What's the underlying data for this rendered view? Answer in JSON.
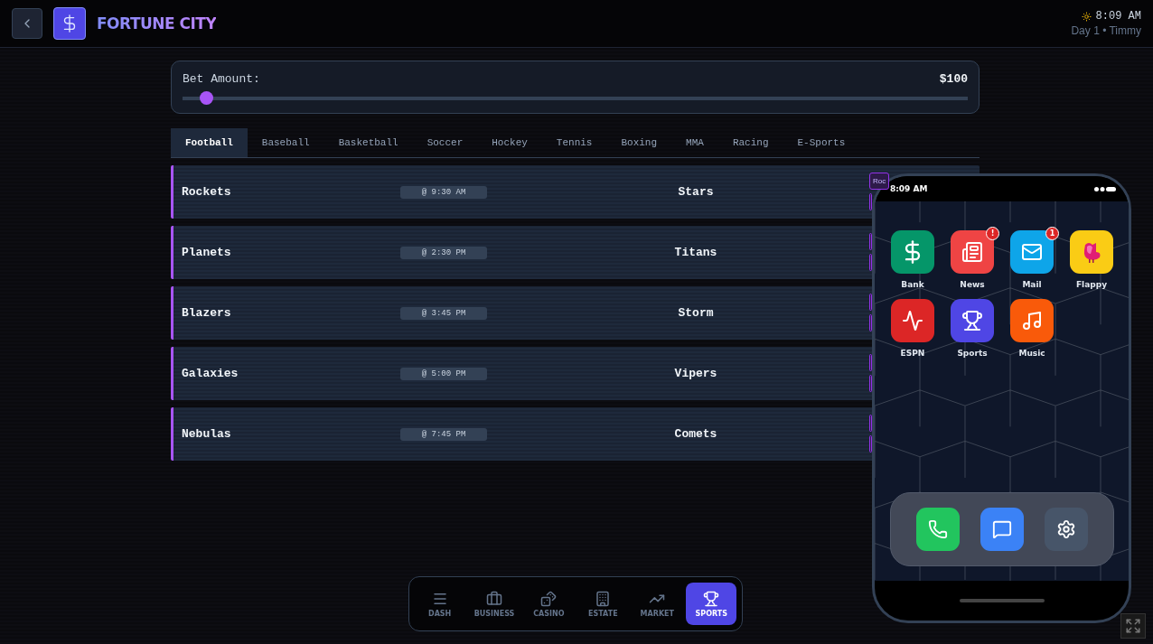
{
  "header": {
    "title": "FORTUNE CITY",
    "time": "8:09 AM",
    "subtitle": "Day 1 • Timmy"
  },
  "bet": {
    "label": "Bet Amount:",
    "value": "$100",
    "level": 0.03
  },
  "tabs": [
    {
      "label": "Football",
      "selected": true
    },
    {
      "label": "Baseball",
      "selected": false
    },
    {
      "label": "Basketball",
      "selected": false
    },
    {
      "label": "Soccer",
      "selected": false
    },
    {
      "label": "Hockey",
      "selected": false
    },
    {
      "label": "Tennis",
      "selected": false
    },
    {
      "label": "Boxing",
      "selected": false
    },
    {
      "label": "MMA",
      "selected": false
    },
    {
      "label": "Racing",
      "selected": false
    },
    {
      "label": "E-Sports",
      "selected": false
    }
  ],
  "games": [
    {
      "home": "Rockets",
      "time": "@ 9:30 AM",
      "away": "Stars",
      "bet_label": "Roc"
    },
    {
      "home": "Planets",
      "time": "@ 2:30 PM",
      "away": "Titans"
    },
    {
      "home": "Blazers",
      "time": "@ 3:45 PM",
      "away": "Storm"
    },
    {
      "home": "Galaxies",
      "time": "@ 5:00 PM",
      "away": "Vipers"
    },
    {
      "home": "Nebulas",
      "time": "@ 7:45 PM",
      "away": "Comets"
    }
  ],
  "phone": {
    "time": "8:09 AM",
    "apps": [
      {
        "name": "Bank",
        "kind": "bank",
        "color": "#059669"
      },
      {
        "name": "News",
        "kind": "news",
        "color": "#ef4444",
        "badge": "!"
      },
      {
        "name": "Mail",
        "kind": "mail",
        "color": "#0ea5e9",
        "badge": "1"
      },
      {
        "name": "Flappy",
        "kind": "flappy",
        "color": "#facc15"
      },
      {
        "name": "ESPN",
        "kind": "espn",
        "color": "#dc2626"
      },
      {
        "name": "Sports",
        "kind": "sports",
        "color": "#4f46e5"
      },
      {
        "name": "Music",
        "kind": "music",
        "color": "#f95a0a"
      }
    ],
    "dock": [
      {
        "kind": "phone",
        "color": "#22c55e"
      },
      {
        "kind": "messages",
        "color": "#3b82f6"
      },
      {
        "kind": "settings",
        "color": "#475569"
      }
    ]
  },
  "nav": [
    {
      "label": "DASH",
      "kind": "dash",
      "selected": false
    },
    {
      "label": "BUSINESS",
      "kind": "business",
      "selected": false
    },
    {
      "label": "CASINO",
      "kind": "casino",
      "selected": false
    },
    {
      "label": "ESTATE",
      "kind": "estate",
      "selected": false
    },
    {
      "label": "MARKET",
      "kind": "market",
      "selected": false
    },
    {
      "label": "SPORTS",
      "kind": "sports",
      "selected": true
    }
  ]
}
